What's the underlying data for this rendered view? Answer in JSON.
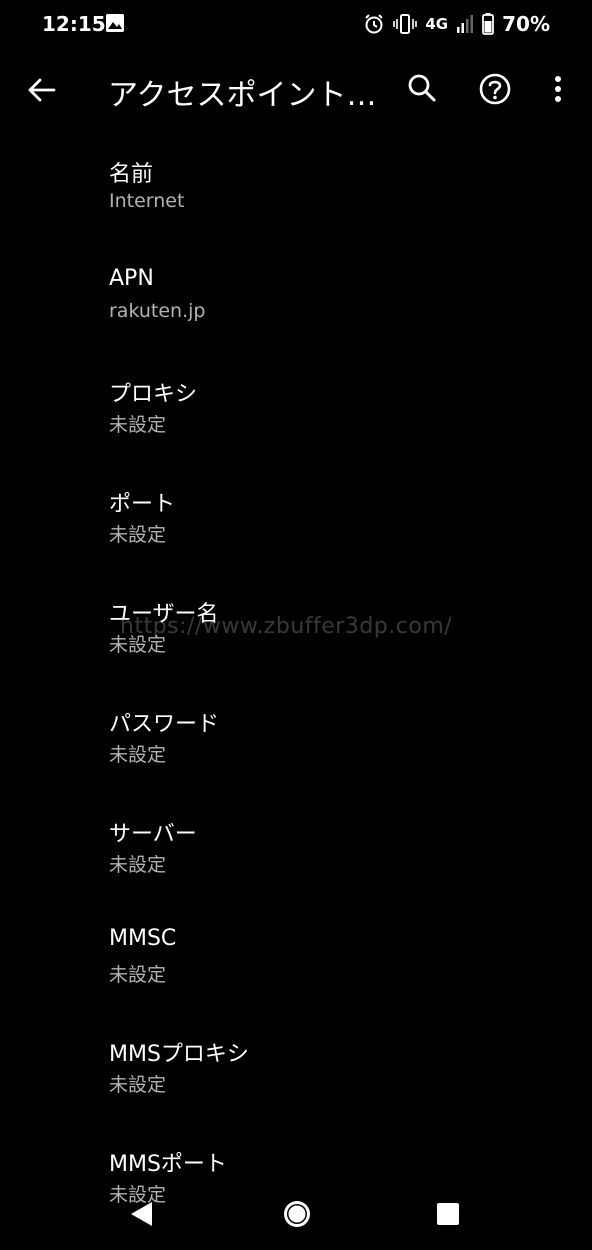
{
  "status_bar": {
    "time": "12:15",
    "network": "4G",
    "battery": "70%",
    "icons": [
      "image-icon",
      "alarm-icon",
      "vibrate-icon",
      "signal-icon",
      "battery-icon"
    ]
  },
  "app_bar": {
    "title": "アクセスポイント…",
    "icons": [
      "back-arrow-icon",
      "search-icon",
      "help-icon",
      "more-vert-icon"
    ]
  },
  "settings": [
    {
      "label": "名前",
      "value": "Internet"
    },
    {
      "label": "APN",
      "value": "rakuten.jp"
    },
    {
      "label": "プロキシ",
      "value": "未設定"
    },
    {
      "label": "ポート",
      "value": "未設定"
    },
    {
      "label": "ユーザー名",
      "value": "未設定"
    },
    {
      "label": "パスワード",
      "value": "未設定"
    },
    {
      "label": "サーバー",
      "value": "未設定"
    },
    {
      "label": "MMSC",
      "value": "未設定"
    },
    {
      "label": "MMSプロキシ",
      "value": "未設定"
    },
    {
      "label": "MMSポート",
      "value": "未設定"
    }
  ],
  "watermark": "https://www.zbuffer3dp.com/",
  "nav_bar": {
    "icons": [
      "nav-back-icon",
      "nav-home-icon",
      "nav-recents-icon"
    ]
  },
  "colors": {
    "background": "#000000",
    "primary_text": "#ffffff",
    "secondary_text": "#b3b3b3"
  }
}
